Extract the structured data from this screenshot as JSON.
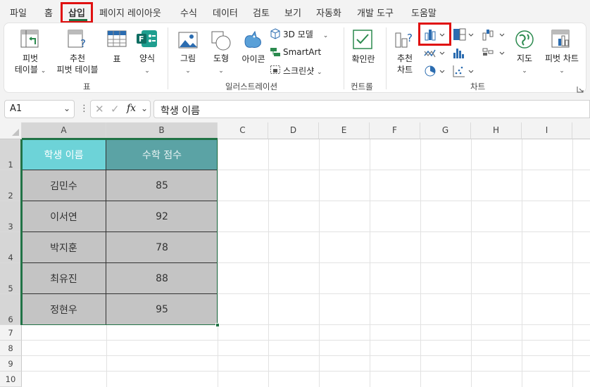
{
  "tabs": [
    "파일",
    "홈",
    "삽입",
    "페이지 레이아웃",
    "수식",
    "데이터",
    "검토",
    "보기",
    "자동화",
    "개발 도구",
    "도움말"
  ],
  "active_tab": "삽입",
  "ribbon": {
    "pivot_table": "피벗\n테이블",
    "recommended_pivot": "추천\n피벗 테이블",
    "table": "표",
    "forms": "양식",
    "group_table": "표",
    "pictures": "그림",
    "shapes": "도형",
    "icons": "아이콘",
    "models_3d": "3D 모델",
    "smartart": "SmartArt",
    "screenshot": "스크린샷",
    "group_illustrations": "일러스트레이션",
    "checkbox": "확인란",
    "group_controls": "컨트롤",
    "recommended_charts": "추천\n차트",
    "maps": "지도",
    "pivot_chart": "피벗 차트",
    "group_charts": "차트"
  },
  "formula_bar": {
    "name_box": "A1",
    "fx": "fx",
    "formula": "학생 이름"
  },
  "columns": [
    "A",
    "B",
    "C",
    "D",
    "E",
    "F",
    "G",
    "H",
    "I"
  ],
  "rows": [
    "1",
    "2",
    "3",
    "4",
    "5",
    "6",
    "7",
    "8",
    "9",
    "10"
  ],
  "table": {
    "headers": [
      "학생 이름",
      "수학 점수"
    ],
    "rows": [
      [
        "김민수",
        "85"
      ],
      [
        "이서연",
        "92"
      ],
      [
        "박지훈",
        "78"
      ],
      [
        "최유진",
        "88"
      ],
      [
        "정현우",
        "95"
      ]
    ]
  },
  "colors": {
    "header_a": "#6dd3d8",
    "header_b": "#5ba3a5",
    "data_fill": "#c4c4c4",
    "highlight": "#e01010",
    "selection": "#217346"
  }
}
